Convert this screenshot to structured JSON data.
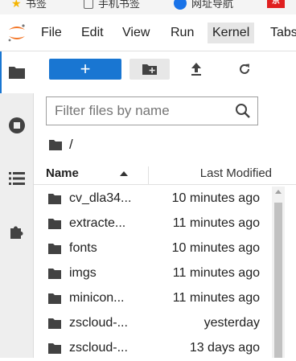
{
  "bookmarks": [
    {
      "label": "书签",
      "icon": "star-icon"
    },
    {
      "label": "手机书签",
      "icon": "phone-icon"
    },
    {
      "label": "网址导航",
      "icon": "edge-icon"
    },
    {
      "label": "京",
      "icon": "jd-icon"
    }
  ],
  "menu": {
    "logo": "jupyter-logo-icon",
    "items": [
      "File",
      "Edit",
      "View",
      "Run",
      "Kernel",
      "Tabs"
    ],
    "active": "Kernel"
  },
  "sidebar": {
    "icons": [
      "folder-icon",
      "running-icon",
      "commands-icon",
      "extensions-icon"
    ],
    "active": "folder-icon"
  },
  "toolbar": {
    "new_label": "+",
    "new_folder_icon": "new-folder-icon",
    "upload_icon": "upload-icon",
    "refresh_icon": "refresh-icon"
  },
  "filter": {
    "placeholder": "Filter files by name",
    "value": ""
  },
  "breadcrumb": {
    "path": "/"
  },
  "table": {
    "columns": {
      "name": "Name",
      "modified": "Last Modified"
    },
    "rows": [
      {
        "name": "cv_dla34...",
        "modified": "10 minutes ago",
        "type": "folder"
      },
      {
        "name": "extracte...",
        "modified": "11 minutes ago",
        "type": "folder"
      },
      {
        "name": "fonts",
        "modified": "10 minutes ago",
        "type": "folder"
      },
      {
        "name": "imgs",
        "modified": "11 minutes ago",
        "type": "folder"
      },
      {
        "name": "minicon...",
        "modified": "11 minutes ago",
        "type": "folder"
      },
      {
        "name": "zscloud-...",
        "modified": "yesterday",
        "type": "folder"
      },
      {
        "name": "zscloud-...",
        "modified": "13 days ago",
        "type": "folder"
      }
    ]
  },
  "colors": {
    "accent": "#1976d2",
    "logo": "#f37626",
    "icon": "#424242"
  }
}
